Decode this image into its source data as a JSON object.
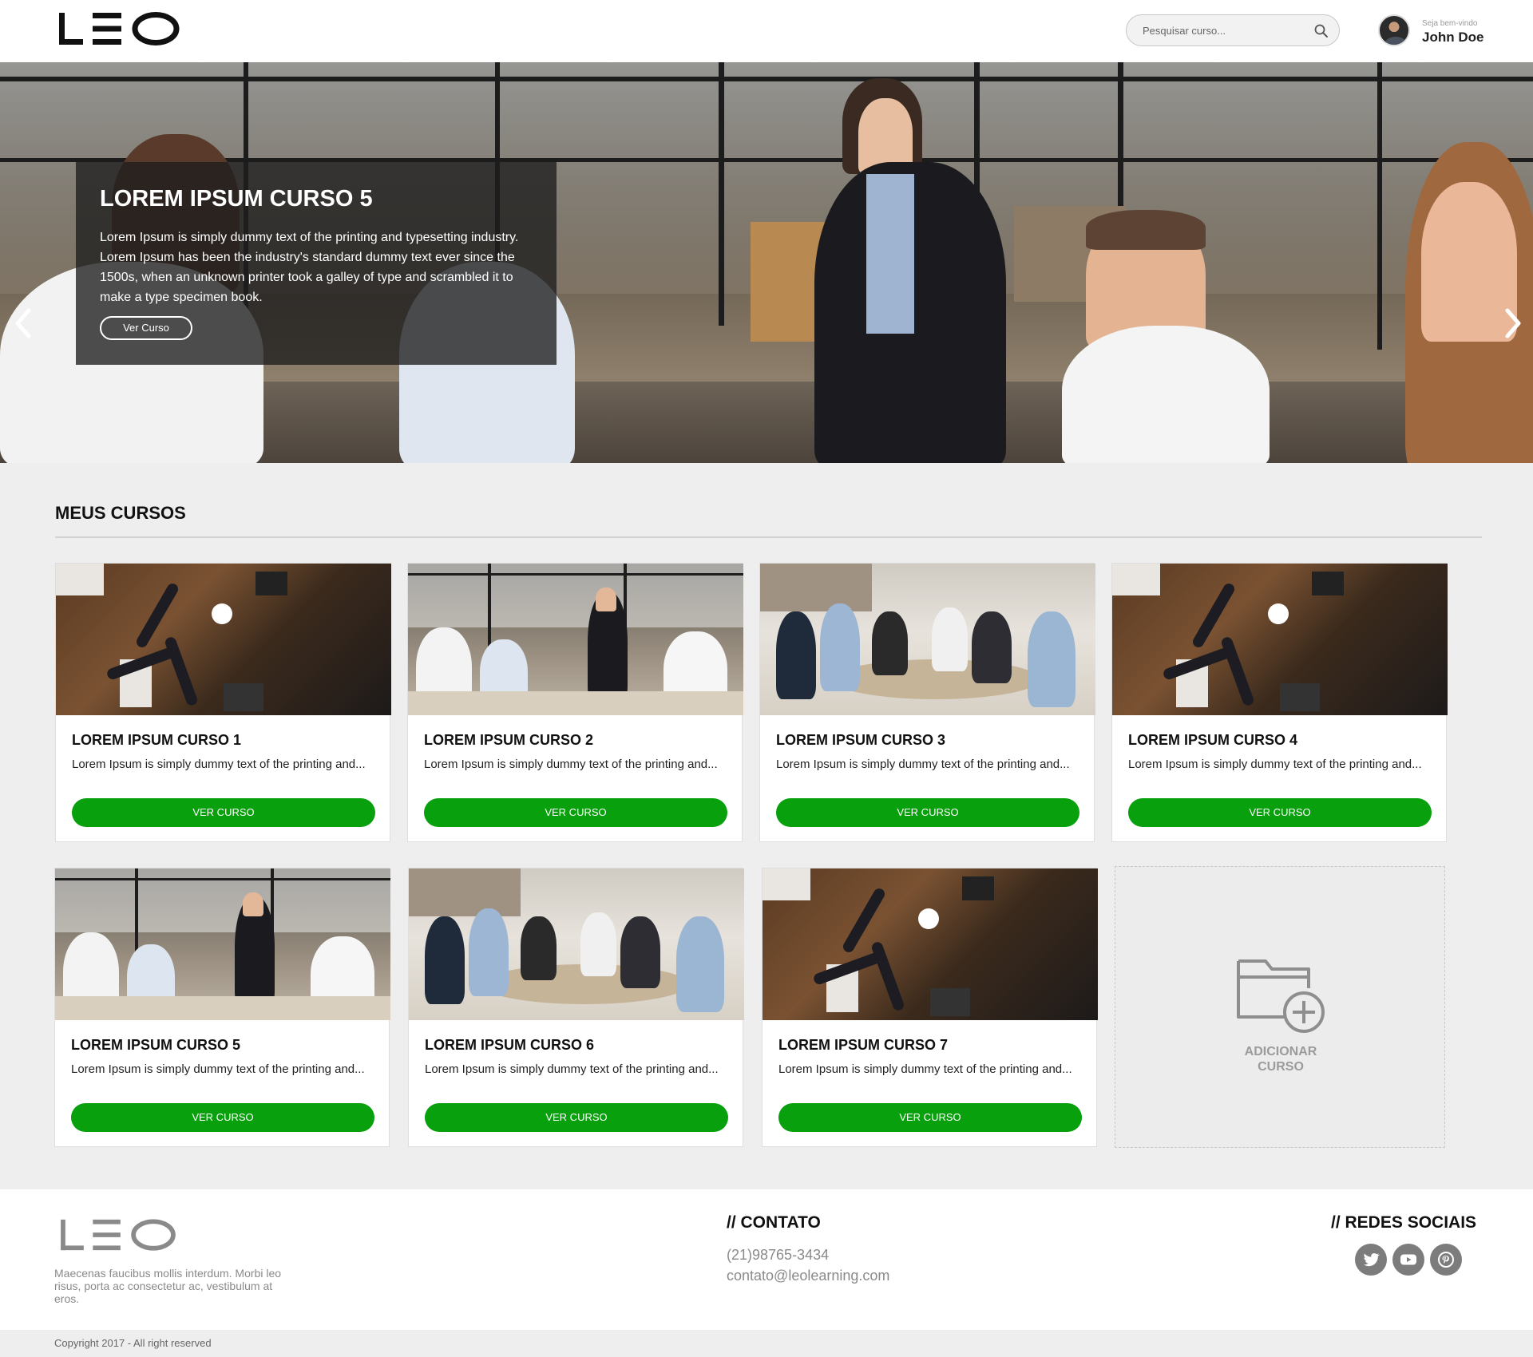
{
  "header": {
    "logo_text": "LEO",
    "search_placeholder": "Pesquisar curso...",
    "welcome": "Seja bem-vindo",
    "user_name": "John Doe"
  },
  "hero": {
    "title": "LOREM IPSUM CURSO 5",
    "text": "Lorem Ipsum is simply dummy text of the printing and typesetting industry. Lorem Ipsum has been the industry's standard dummy text ever since the 1500s, when an unknown printer took a galley of type and scrambled it to make a type specimen book.",
    "button": "Ver Curso"
  },
  "section": {
    "title": "MEUS CURSOS"
  },
  "courses": [
    {
      "title": "LOREM IPSUM CURSO 1",
      "text": "Lorem Ipsum is simply dummy text of the printing and...",
      "button": "VER CURSO"
    },
    {
      "title": "LOREM IPSUM CURSO 2",
      "text": "Lorem Ipsum is simply dummy text of the printing and...",
      "button": "VER CURSO"
    },
    {
      "title": "LOREM IPSUM CURSO 3",
      "text": "Lorem Ipsum is simply dummy text of the printing and...",
      "button": "VER CURSO"
    },
    {
      "title": "LOREM IPSUM CURSO 4",
      "text": "Lorem Ipsum is simply dummy text of the printing and...",
      "button": "VER CURSO"
    },
    {
      "title": "LOREM IPSUM CURSO 5",
      "text": "Lorem Ipsum is simply dummy text of the printing and...",
      "button": "VER CURSO"
    },
    {
      "title": "LOREM IPSUM CURSO 6",
      "text": "Lorem Ipsum is simply dummy text of the printing and...",
      "button": "VER CURSO"
    },
    {
      "title": "LOREM IPSUM CURSO 7",
      "text": "Lorem Ipsum is simply dummy text of the printing and...",
      "button": "VER CURSO"
    }
  ],
  "add_course": {
    "line1": "ADICIONAR",
    "line2": "CURSO"
  },
  "footer": {
    "about": "Maecenas faucibus mollis interdum. Morbi leo risus, porta ac consectetur ac, vestibulum at eros.",
    "contact_heading": "// CONTATO",
    "phone": "(21)98765-3434",
    "email": "contato@leolearning.com",
    "social_heading": "// REDES SOCIAIS",
    "social_icons": [
      "twitter-icon",
      "youtube-icon",
      "pinterest-icon"
    ],
    "copyright": "Copyright 2017 - All right reserved"
  },
  "colors": {
    "accent_green": "#08a00c",
    "page_bg": "#eeeeee",
    "text_gray": "#8a8a8a"
  }
}
